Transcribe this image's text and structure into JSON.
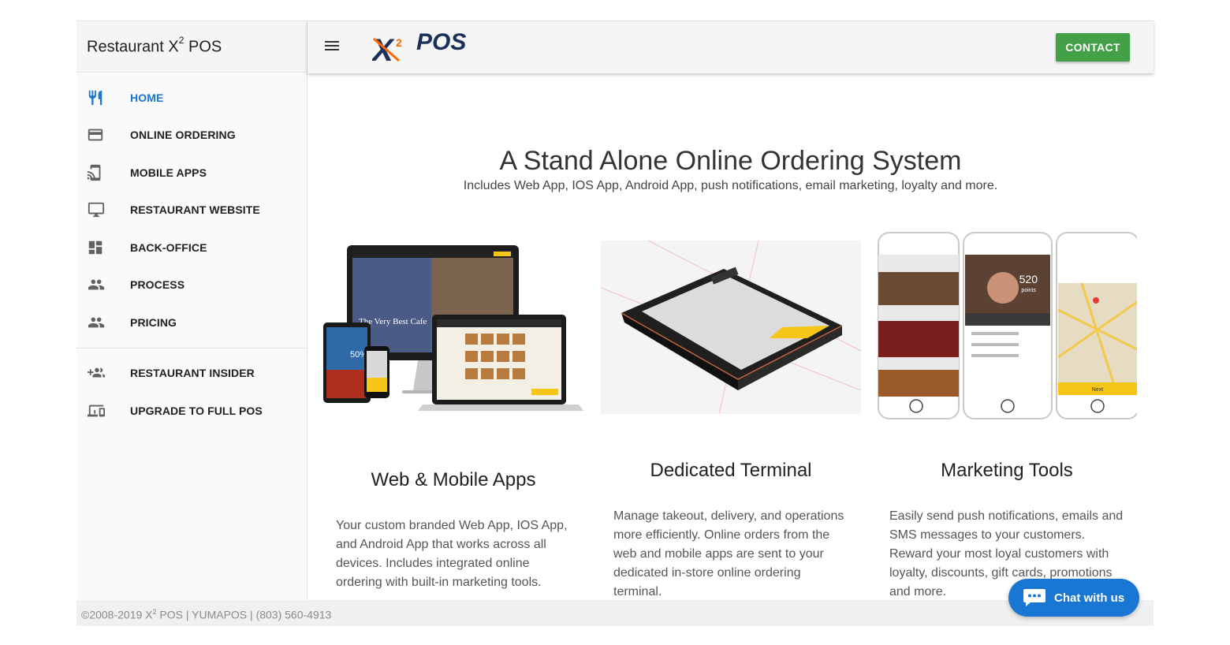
{
  "sidebar": {
    "title": "Restaurant X",
    "title_sup": "2",
    "title_suffix": " POS",
    "items": [
      {
        "label": "HOME",
        "icon": "utensils-icon",
        "active": true
      },
      {
        "label": "ONLINE ORDERING",
        "icon": "credit-card-icon"
      },
      {
        "label": "MOBILE APPS",
        "icon": "cast-to-device-icon"
      },
      {
        "label": "RESTAURANT WEBSITE",
        "icon": "monitor-icon"
      },
      {
        "label": "BACK-OFFICE",
        "icon": "dashboard-icon"
      },
      {
        "label": "PROCESS",
        "icon": "people-icon"
      },
      {
        "label": "PRICING",
        "icon": "people-icon"
      }
    ],
    "secondary_items": [
      {
        "label": "RESTAURANT INSIDER",
        "icon": "add-group-icon"
      },
      {
        "label": "UPGRADE TO FULL POS",
        "icon": "devices-icon"
      }
    ]
  },
  "topbar": {
    "logo_x": "X",
    "logo_sup": "2",
    "logo_text": "POS",
    "contact_label": "CONTACT"
  },
  "hero": {
    "title": "A Stand Alone Online Ordering System",
    "subtitle": "Includes Web App, IOS App, Android App, push notifications, email marketing, loyalty and more."
  },
  "features": [
    {
      "title": "Web & Mobile Apps",
      "text": "Your custom branded Web App, IOS App, and Android App that works across all devices. Includes integrated online ordering with built-in marketing tools.",
      "mock": {
        "site_name": "The Very Best Cafe",
        "badge": "50%"
      }
    },
    {
      "title": "Dedicated Terminal",
      "text": "Manage takeout, delivery, and operations more efficiently. Online orders from the web and mobile apps are sent to your dedicated in-store online ordering terminal."
    },
    {
      "title": "Marketing Tools",
      "text": "Easily send push notifications, emails and SMS messages to your customers. Reward your most loyal customers with loyalty, discounts, gift cards, promotions and more.",
      "mock": {
        "points": "520",
        "points_label": "points",
        "next_label": "Next"
      }
    }
  ],
  "footer": {
    "prefix": "©2008-2019 X",
    "sup": "2",
    "rest": " POS | YUMAPOS | (803) 560-4913"
  },
  "chat": {
    "label": "Chat with us"
  },
  "colors": {
    "accent_blue": "#1976d2",
    "contact_green": "#43a047",
    "logo_navy": "#1a2f5a",
    "logo_orange": "#ff6a00",
    "app_yellow": "#f5c518"
  }
}
